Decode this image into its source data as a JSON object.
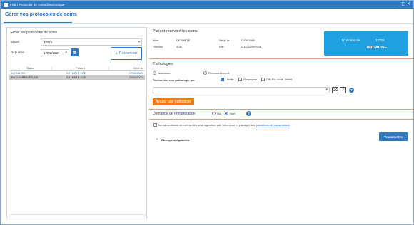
{
  "window": {
    "title": "FSE / Protocole de Soins Électronique",
    "controls": "_ □ ✕"
  },
  "tab": {
    "label": "Gérer vos protocoles de soins"
  },
  "filter": {
    "title": "Filtrer les protocoles de soins",
    "statut_label": "Statut",
    "statut_value": "TOUS",
    "depuis_label": "Depuis le",
    "depuis_value": "17/02/2021",
    "search_label": "Rechercher"
  },
  "table": {
    "headers": [
      "Statut",
      "Patient",
      "Créé le"
    ],
    "rows": [
      [
        "INITIALISE",
        "DEYMETE ZOE",
        "17/02/2021"
      ],
      [
        "EN COURS D'ÉTUDE",
        "DEYMETE ZOE",
        "17/02/2021"
      ]
    ]
  },
  "patient": {
    "title": "Patient recevant les soins",
    "nom_label": "Nom",
    "nom_value": "DEYMETE",
    "prenom_label": "Prénom",
    "prenom_value": "ZOE",
    "ne_label": "Né(e) le",
    "ne_value": "12/09/1980",
    "nir_label": "NIR",
    "nir_value": "1410104097008"
  },
  "protocole": {
    "num_label": "N° Protocole",
    "num_value": "12724",
    "status": "INITIALISE"
  },
  "pathologies": {
    "title": "Pathologies",
    "opt_admission": "Admission",
    "opt_renouvellement": "Renouvellement",
    "search_label": "Rechercher une pathologie par",
    "opt_libelle": "Libellé",
    "opt_synonyme": "Synonyme",
    "opt_cim10": "CIM10 : code, libellé",
    "add_button": "Ajouter une pathologie"
  },
  "remuneration": {
    "label": "Demande de rémunération",
    "opt_oui": "Oui",
    "opt_non": "Non"
  },
  "consent": {
    "text": "La transmission des présentes vaut signature par moi-même et j'accepte les",
    "link": "conditions de transmission"
  },
  "actions": {
    "transmettre": "Transmettre",
    "champs": "Champs obligatoires"
  },
  "colors": {
    "accent": "#2f7ac2",
    "orange": "#ef7a1a",
    "proto_bg": "#20a0e0"
  }
}
